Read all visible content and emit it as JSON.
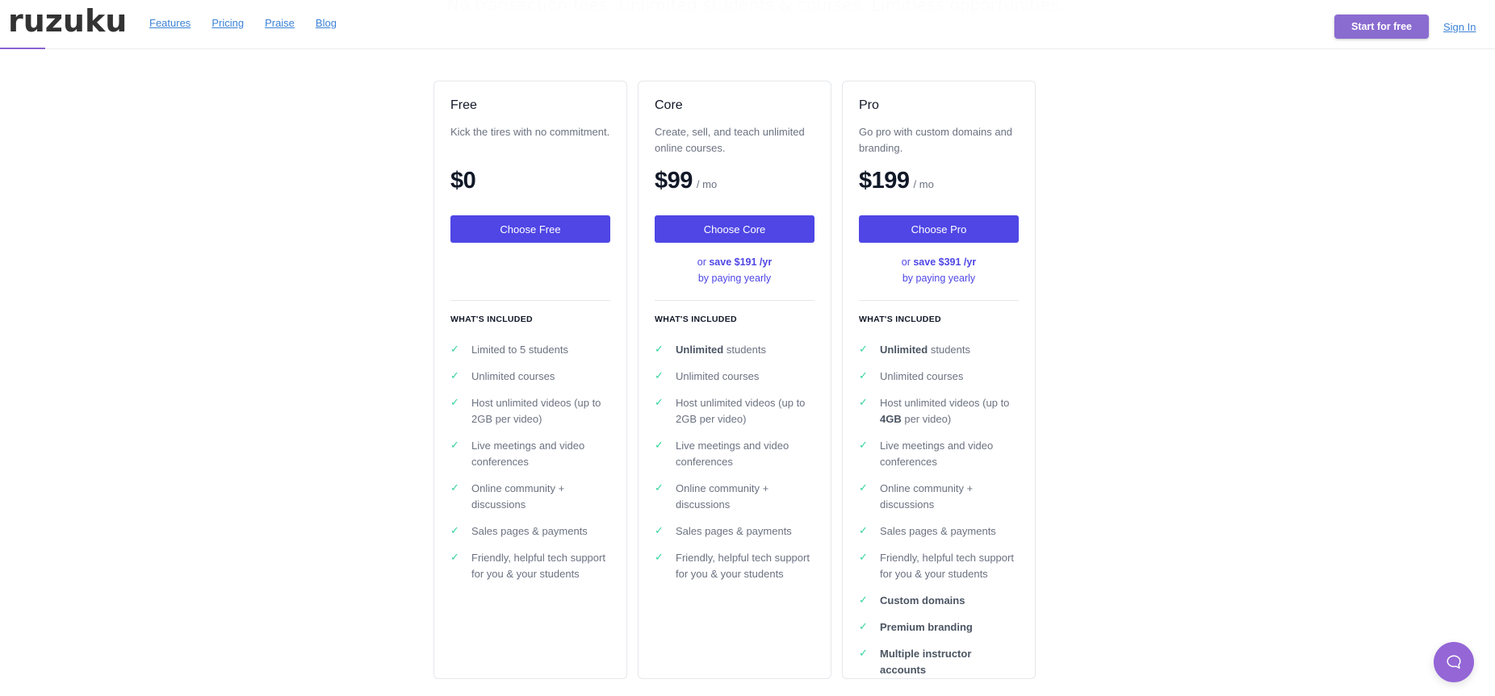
{
  "hero": {
    "faded_subtitle": "No transaction fees. Unlimited students & courses. Limitless opportunities."
  },
  "header": {
    "logo": "ruzuku",
    "nav": [
      "Features",
      "Pricing",
      "Praise",
      "Blog"
    ],
    "start_button": "Start for free",
    "signin": "Sign In",
    "scroll_progress_fraction": 0.03
  },
  "colors": {
    "brand_purple": "#8a6bd0",
    "button_indigo": "#4f46e5",
    "check_green": "#34d399",
    "link_blue": "#3b82d6"
  },
  "pricing": {
    "included_label": "WHAT'S INCLUDED",
    "plans": [
      {
        "name": "Free",
        "description": "Kick the tires with no commitment.",
        "price": "$0",
        "per": "",
        "button": "Choose Free",
        "save_prefix": "",
        "save_amount": "",
        "save_suffix": "",
        "features": [
          {
            "bold": "",
            "text": "Limited to 5 students"
          },
          {
            "bold": "",
            "text": "Unlimited courses"
          },
          {
            "bold": "",
            "text": "Host unlimited videos (up to 2GB per video)"
          },
          {
            "bold": "",
            "text": "Live meetings and video conferences"
          },
          {
            "bold": "",
            "text": "Online community + discussions"
          },
          {
            "bold": "",
            "text": "Sales pages & payments"
          },
          {
            "bold": "",
            "text": "Friendly, helpful tech support for you & your students"
          }
        ]
      },
      {
        "name": "Core",
        "description": "Create, sell, and teach unlimited online courses.",
        "price": "$99",
        "per": "/ mo",
        "button": "Choose Core",
        "save_prefix": "or ",
        "save_amount": "save $191 /yr",
        "save_suffix": "by paying yearly",
        "features": [
          {
            "bold": "Unlimited",
            "text": " students"
          },
          {
            "bold": "",
            "text": "Unlimited courses"
          },
          {
            "bold": "",
            "text": "Host unlimited videos (up to 2GB per video)"
          },
          {
            "bold": "",
            "text": "Live meetings and video conferences"
          },
          {
            "bold": "",
            "text": "Online community + discussions"
          },
          {
            "bold": "",
            "text": "Sales pages & payments"
          },
          {
            "bold": "",
            "text": "Friendly, helpful tech support for you & your students"
          }
        ]
      },
      {
        "name": "Pro",
        "description": "Go pro with custom domains and branding.",
        "price": "$199",
        "per": "/ mo",
        "button": "Choose Pro",
        "save_prefix": "or ",
        "save_amount": "save $391 /yr",
        "save_suffix": "by paying yearly",
        "features": [
          {
            "bold": "Unlimited",
            "text": " students"
          },
          {
            "bold": "",
            "text": "Unlimited courses"
          },
          {
            "bold": "",
            "text": "Host unlimited videos (up to ",
            "bold2": "4GB",
            "text2": " per video)"
          },
          {
            "bold": "",
            "text": "Live meetings and video conferences"
          },
          {
            "bold": "",
            "text": "Online community + discussions"
          },
          {
            "bold": "",
            "text": "Sales pages & payments"
          },
          {
            "bold": "",
            "text": "Friendly, helpful tech support for you & your students"
          },
          {
            "bold": "Custom domains",
            "text": ""
          },
          {
            "bold": "Premium branding",
            "text": ""
          },
          {
            "bold": "Multiple instructor accounts",
            "text": ""
          }
        ]
      }
    ]
  },
  "chat_widget": {
    "icon": "chat-bubble-icon"
  }
}
